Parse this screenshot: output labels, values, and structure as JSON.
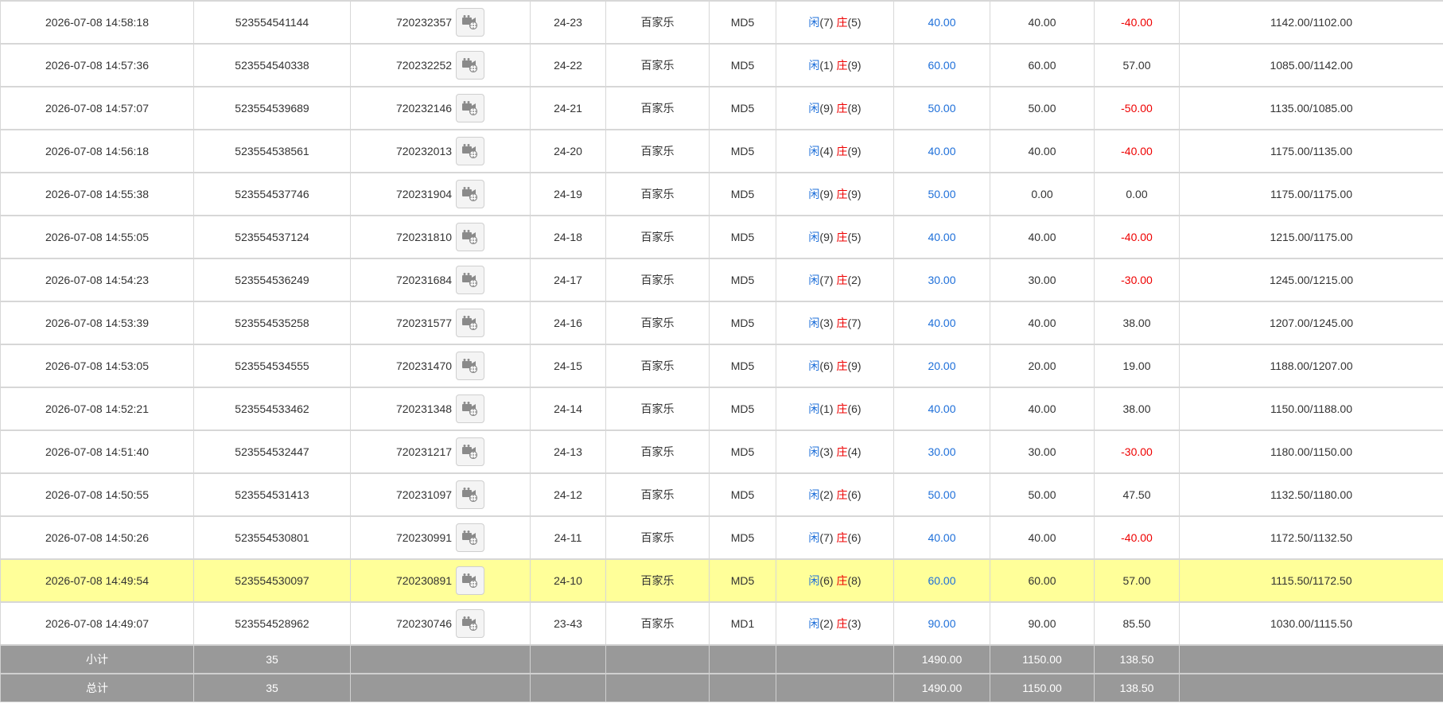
{
  "rows": [
    {
      "time": "2026-07-08 14:58:18",
      "bet_id": "523554541144",
      "round_id": "720232357",
      "shoe": "24-23",
      "game": "百家乐",
      "table": "MD5",
      "xian_label": "闲",
      "xian_value": "(7)",
      "zhuang_label": "庄",
      "zhuang_value": "(5)",
      "bet": "40.00",
      "valid": "40.00",
      "win_loss": "-40.00",
      "win_color": "red",
      "balance": "1142.00/1102.00",
      "highlight": false
    },
    {
      "time": "2026-07-08 14:57:36",
      "bet_id": "523554540338",
      "round_id": "720232252",
      "shoe": "24-22",
      "game": "百家乐",
      "table": "MD5",
      "xian_label": "闲",
      "xian_value": "(1)",
      "zhuang_label": "庄",
      "zhuang_value": "(9)",
      "bet": "60.00",
      "valid": "60.00",
      "win_loss": "57.00",
      "win_color": "normal",
      "balance": "1085.00/1142.00",
      "highlight": false
    },
    {
      "time": "2026-07-08 14:57:07",
      "bet_id": "523554539689",
      "round_id": "720232146",
      "shoe": "24-21",
      "game": "百家乐",
      "table": "MD5",
      "xian_label": "闲",
      "xian_value": "(9)",
      "zhuang_label": "庄",
      "zhuang_value": "(8)",
      "bet": "50.00",
      "valid": "50.00",
      "win_loss": "-50.00",
      "win_color": "red",
      "balance": "1135.00/1085.00",
      "highlight": false
    },
    {
      "time": "2026-07-08 14:56:18",
      "bet_id": "523554538561",
      "round_id": "720232013",
      "shoe": "24-20",
      "game": "百家乐",
      "table": "MD5",
      "xian_label": "闲",
      "xian_value": "(4)",
      "zhuang_label": "庄",
      "zhuang_value": "(9)",
      "bet": "40.00",
      "valid": "40.00",
      "win_loss": "-40.00",
      "win_color": "red",
      "balance": "1175.00/1135.00",
      "highlight": false
    },
    {
      "time": "2026-07-08 14:55:38",
      "bet_id": "523554537746",
      "round_id": "720231904",
      "shoe": "24-19",
      "game": "百家乐",
      "table": "MD5",
      "xian_label": "闲",
      "xian_value": "(9)",
      "zhuang_label": "庄",
      "zhuang_value": "(9)",
      "bet": "50.00",
      "valid": "0.00",
      "win_loss": "0.00",
      "win_color": "normal",
      "balance": "1175.00/1175.00",
      "highlight": false
    },
    {
      "time": "2026-07-08 14:55:05",
      "bet_id": "523554537124",
      "round_id": "720231810",
      "shoe": "24-18",
      "game": "百家乐",
      "table": "MD5",
      "xian_label": "闲",
      "xian_value": "(9)",
      "zhuang_label": "庄",
      "zhuang_value": "(5)",
      "bet": "40.00",
      "valid": "40.00",
      "win_loss": "-40.00",
      "win_color": "red",
      "balance": "1215.00/1175.00",
      "highlight": false
    },
    {
      "time": "2026-07-08 14:54:23",
      "bet_id": "523554536249",
      "round_id": "720231684",
      "shoe": "24-17",
      "game": "百家乐",
      "table": "MD5",
      "xian_label": "闲",
      "xian_value": "(7)",
      "zhuang_label": "庄",
      "zhuang_value": "(2)",
      "bet": "30.00",
      "valid": "30.00",
      "win_loss": "-30.00",
      "win_color": "red",
      "balance": "1245.00/1215.00",
      "highlight": false
    },
    {
      "time": "2026-07-08 14:53:39",
      "bet_id": "523554535258",
      "round_id": "720231577",
      "shoe": "24-16",
      "game": "百家乐",
      "table": "MD5",
      "xian_label": "闲",
      "xian_value": "(3)",
      "zhuang_label": "庄",
      "zhuang_value": "(7)",
      "bet": "40.00",
      "valid": "40.00",
      "win_loss": "38.00",
      "win_color": "normal",
      "balance": "1207.00/1245.00",
      "highlight": false
    },
    {
      "time": "2026-07-08 14:53:05",
      "bet_id": "523554534555",
      "round_id": "720231470",
      "shoe": "24-15",
      "game": "百家乐",
      "table": "MD5",
      "xian_label": "闲",
      "xian_value": "(6)",
      "zhuang_label": "庄",
      "zhuang_value": "(9)",
      "bet": "20.00",
      "valid": "20.00",
      "win_loss": "19.00",
      "win_color": "normal",
      "balance": "1188.00/1207.00",
      "highlight": false
    },
    {
      "time": "2026-07-08 14:52:21",
      "bet_id": "523554533462",
      "round_id": "720231348",
      "shoe": "24-14",
      "game": "百家乐",
      "table": "MD5",
      "xian_label": "闲",
      "xian_value": "(1)",
      "zhuang_label": "庄",
      "zhuang_value": "(6)",
      "bet": "40.00",
      "valid": "40.00",
      "win_loss": "38.00",
      "win_color": "normal",
      "balance": "1150.00/1188.00",
      "highlight": false
    },
    {
      "time": "2026-07-08 14:51:40",
      "bet_id": "523554532447",
      "round_id": "720231217",
      "shoe": "24-13",
      "game": "百家乐",
      "table": "MD5",
      "xian_label": "闲",
      "xian_value": "(3)",
      "zhuang_label": "庄",
      "zhuang_value": "(4)",
      "bet": "30.00",
      "valid": "30.00",
      "win_loss": "-30.00",
      "win_color": "red",
      "balance": "1180.00/1150.00",
      "highlight": false
    },
    {
      "time": "2026-07-08 14:50:55",
      "bet_id": "523554531413",
      "round_id": "720231097",
      "shoe": "24-12",
      "game": "百家乐",
      "table": "MD5",
      "xian_label": "闲",
      "xian_value": "(2)",
      "zhuang_label": "庄",
      "zhuang_value": "(6)",
      "bet": "50.00",
      "valid": "50.00",
      "win_loss": "47.50",
      "win_color": "normal",
      "balance": "1132.50/1180.00",
      "highlight": false
    },
    {
      "time": "2026-07-08 14:50:26",
      "bet_id": "523554530801",
      "round_id": "720230991",
      "shoe": "24-11",
      "game": "百家乐",
      "table": "MD5",
      "xian_label": "闲",
      "xian_value": "(7)",
      "zhuang_label": "庄",
      "zhuang_value": "(6)",
      "bet": "40.00",
      "valid": "40.00",
      "win_loss": "-40.00",
      "win_color": "red",
      "balance": "1172.50/1132.50",
      "highlight": false
    },
    {
      "time": "2026-07-08 14:49:54",
      "bet_id": "523554530097",
      "round_id": "720230891",
      "shoe": "24-10",
      "game": "百家乐",
      "table": "MD5",
      "xian_label": "闲",
      "xian_value": "(6)",
      "zhuang_label": "庄",
      "zhuang_value": "(8)",
      "bet": "60.00",
      "valid": "60.00",
      "win_loss": "57.00",
      "win_color": "normal",
      "balance": "1115.50/1172.50",
      "highlight": true
    },
    {
      "time": "2026-07-08 14:49:07",
      "bet_id": "523554528962",
      "round_id": "720230746",
      "shoe": "23-43",
      "game": "百家乐",
      "table": "MD1",
      "xian_label": "闲",
      "xian_value": "(2)",
      "zhuang_label": "庄",
      "zhuang_value": "(3)",
      "bet": "90.00",
      "valid": "90.00",
      "win_loss": "85.50",
      "win_color": "normal",
      "balance": "1030.00/1115.50",
      "highlight": false
    }
  ],
  "subtotal": {
    "label": "小计",
    "count": "35",
    "bet": "1490.00",
    "valid": "1150.00",
    "win_loss": "138.50"
  },
  "total": {
    "label": "总计",
    "count": "35",
    "bet": "1490.00",
    "valid": "1150.00",
    "win_loss": "138.50"
  },
  "icons": {
    "replay": "video-replay-icon"
  },
  "colors": {
    "blue": "#1e6fd9",
    "red": "#ee0000",
    "highlight": "#ffff99",
    "summary_bg": "#999999"
  }
}
